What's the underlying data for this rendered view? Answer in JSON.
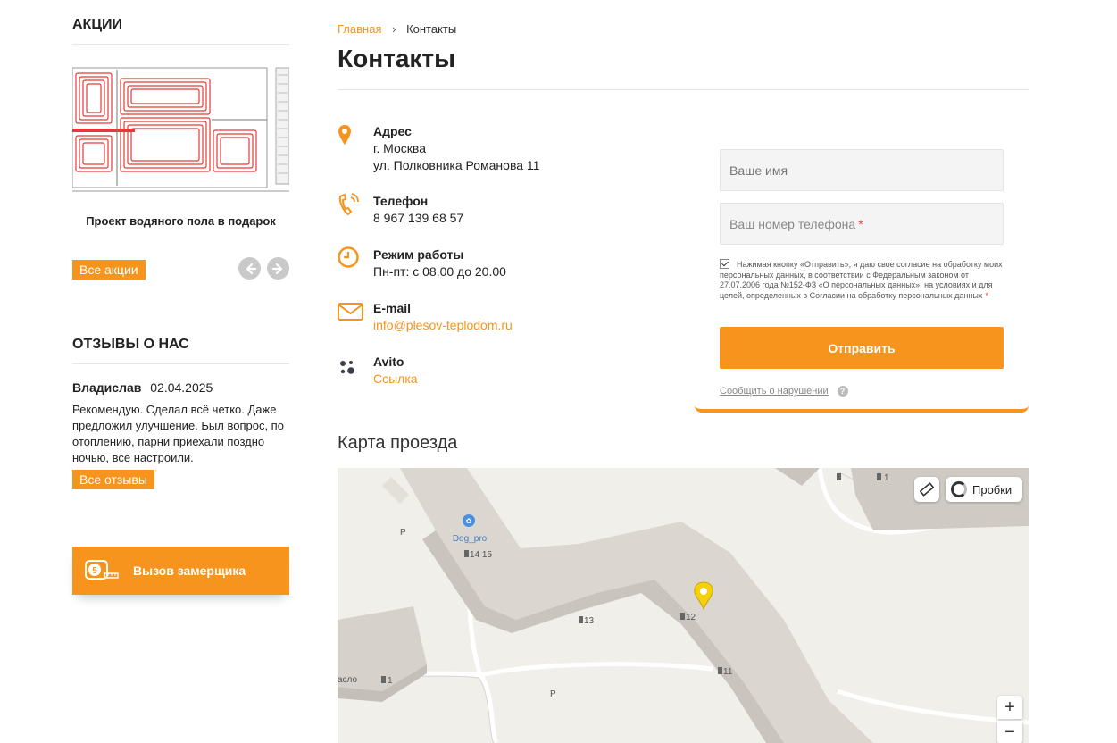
{
  "sidebar": {
    "promos_title": "Акции",
    "promo_caption": "Проект водяного пола в подарок",
    "all_promos": "Все акции",
    "reviews_title": "Отзывы о нас",
    "review": {
      "author": "Владислав",
      "date": "02.04.2025",
      "text": "Рекомендую. Сделал всё четко. Даже предложил улучшение. Был вопрос, по отоплению, парни приехали поздно ночью, все настроили."
    },
    "all_reviews": "Все отзывы",
    "measure_button": "Вызов замерщика",
    "measure_badge": "5"
  },
  "breadcrumb": {
    "home": "Главная",
    "current": "Контакты"
  },
  "page_title": "Контакты",
  "contacts": {
    "address": {
      "label": "Адрес",
      "city": "г. Москва",
      "street": "ул. Полковника Романова 11"
    },
    "phone": {
      "label": "Телефон",
      "value": "8 967 139 68 57"
    },
    "hours": {
      "label": "Режим работы",
      "value": "Пн-пт: с 08.00 до 20.00"
    },
    "email": {
      "label": "E-mail",
      "value": "info@plesov-teplodom.ru"
    },
    "avito": {
      "label": "Avito",
      "value": "Ссылка"
    }
  },
  "form": {
    "name_placeholder": "Ваше имя",
    "phone_placeholder": "Ваш номер телефона",
    "required_mark": "*",
    "consent_text": "Нажимая кнопку «Отправить», я даю свое согласие на обработку моих персональных данных, в соответствии с Федеральным законом от 27.07.2006 года №152-ФЗ «О персональных данных», на условиях и для целей, определенных в Согласии на обработку персональных данных",
    "consent_checked": true,
    "submit": "Отправить",
    "report": "Сообщить о нарушении",
    "help": "?"
  },
  "map": {
    "title": "Карта проезда",
    "traffic_button": "Пробки",
    "zoom_in": "+",
    "zoom_out": "−",
    "labels": {
      "place": "Dog_pro",
      "parking": "P",
      "house_14_15": "14 15",
      "house_13": "13",
      "house_12": "12",
      "house_11": "11",
      "house_1": "1",
      "street_fragment": "асло"
    }
  },
  "colors": {
    "accent": "#f7941d",
    "text": "#222222",
    "muted": "#888888"
  }
}
